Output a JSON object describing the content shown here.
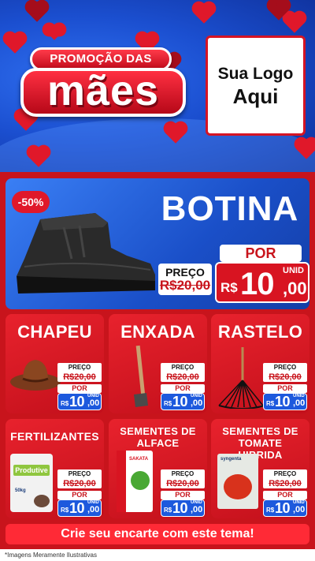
{
  "header": {
    "promo_line1": "PROMOÇÃO DAS",
    "promo_line2": "mães",
    "logo_line1": "Sua Logo",
    "logo_line2": "Aqui"
  },
  "featured": {
    "badge": "-50%",
    "title": "BOTINA",
    "preco_label": "PREÇO",
    "old_price": "R$20,00",
    "por_label": "POR",
    "currency": "R$",
    "price_int": "10",
    "price_dec": ",00",
    "unit": "UNID"
  },
  "products": [
    {
      "title": "CHAPEU",
      "preco_label": "PREÇO",
      "old_price": "R$20,00",
      "por_label": "POR",
      "currency": "R$",
      "price_int": "10",
      "price_dec": ",00",
      "unit": "UNID"
    },
    {
      "title": "ENXADA",
      "preco_label": "PREÇO",
      "old_price": "R$20,00",
      "por_label": "POR",
      "currency": "R$",
      "price_int": "10",
      "price_dec": ",00",
      "unit": "UNID"
    },
    {
      "title": "RASTELO",
      "preco_label": "PREÇO",
      "old_price": "R$20,00",
      "por_label": "POR",
      "currency": "R$",
      "price_int": "10",
      "price_dec": ",00",
      "unit": "UNID"
    },
    {
      "title": "FERTILIZANTES",
      "product_label": "Produtive",
      "weight_label": "50kg",
      "preco_label": "PREÇO",
      "old_price": "R$20,00",
      "por_label": "POR",
      "currency": "R$",
      "price_int": "10",
      "price_dec": ",00",
      "unit": "UNID"
    },
    {
      "title": "SEMENTES DE ALFACE",
      "product_label": "SAKATA",
      "preco_label": "PREÇO",
      "old_price": "R$20,00",
      "por_label": "POR",
      "currency": "R$",
      "price_int": "10",
      "price_dec": ",00",
      "unit": "UNID"
    },
    {
      "title": "SEMENTES DE TOMATE HIBRIDA",
      "product_label": "syngenta",
      "preco_label": "PREÇO",
      "old_price": "R$20,00",
      "por_label": "POR",
      "currency": "R$",
      "price_int": "10",
      "price_dec": ",00",
      "unit": "UNID"
    }
  ],
  "cta": {
    "label": "Crie seu encarte com este tema!"
  },
  "footer": {
    "disclaimer": "*Imagens Meramente Ilustrativas"
  },
  "colors": {
    "red": "#c8141c",
    "blue": "#1d59dd",
    "bright_red": "#ff2a36"
  }
}
